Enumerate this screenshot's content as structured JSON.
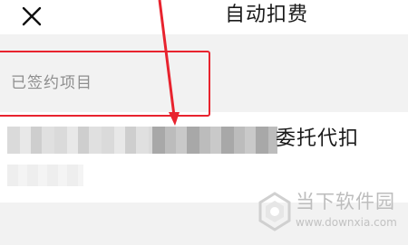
{
  "header": {
    "title": "自动扣费",
    "close_icon": "close-icon"
  },
  "section": {
    "label": "已签约项目"
  },
  "item": {
    "name_suffix": "委托代扣"
  },
  "annotation": {
    "highlight_color": "#e8232e"
  },
  "watermark": {
    "name": "当下软件园",
    "url": "www.downxia.com"
  }
}
